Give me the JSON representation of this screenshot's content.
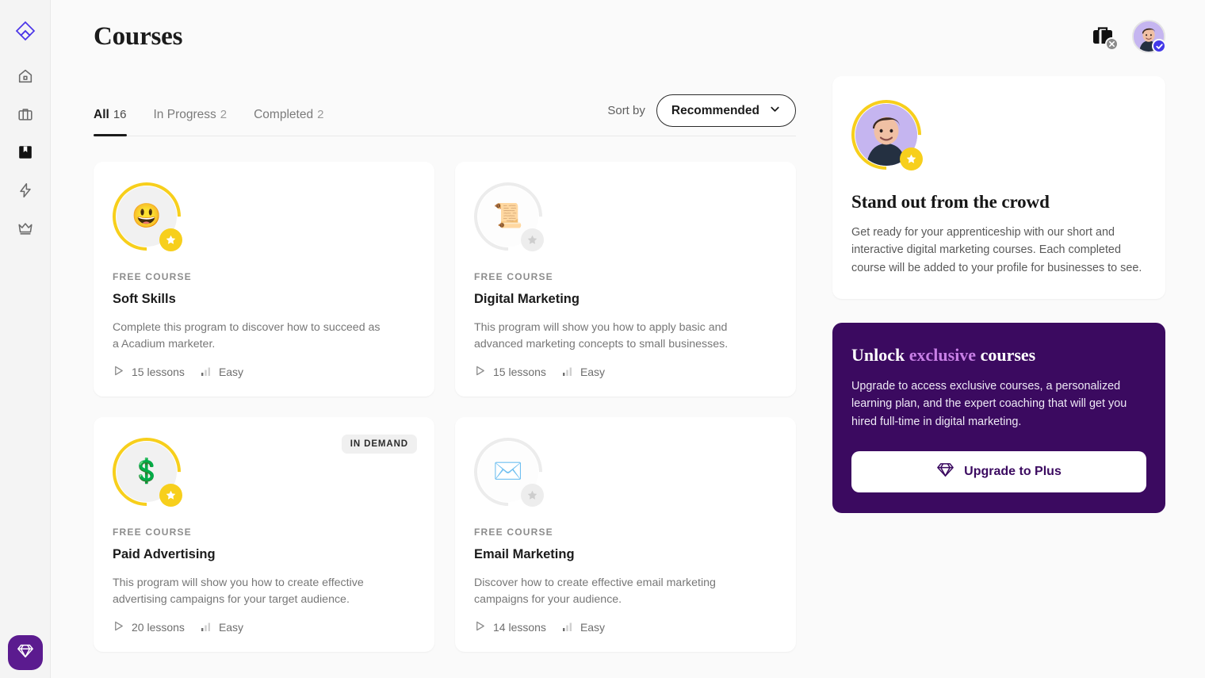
{
  "sidebar": {
    "logo_icon": "acadium-logo-icon",
    "items": [
      {
        "icon": "home-icon",
        "name": "home"
      },
      {
        "icon": "briefcase-icon",
        "name": "jobs"
      },
      {
        "icon": "book-icon",
        "name": "courses",
        "active": true
      },
      {
        "icon": "lightning-icon",
        "name": "activity"
      },
      {
        "icon": "crown-icon",
        "name": "premium"
      }
    ],
    "fab": {
      "icon": "diamond-icon",
      "name": "upgrade-fab"
    }
  },
  "header": {
    "title": "Courses",
    "bag_icon": "briefcase-icon",
    "bag_badge_icon": "close-x-icon",
    "avatar_icon": "user-avatar",
    "verified_icon": "check-badge-icon"
  },
  "tabs": [
    {
      "label": "All",
      "count": "16",
      "active": true
    },
    {
      "label": "In Progress",
      "count": "2",
      "active": false
    },
    {
      "label": "Completed",
      "count": "2",
      "active": false
    }
  ],
  "sort": {
    "label": "Sort by",
    "value": "Recommended",
    "chevron_icon": "chevron-down-icon"
  },
  "courses": [
    {
      "emoji": "😃",
      "emoji_name": "smiley-face-icon",
      "state": "earned",
      "eyebrow": "FREE COURSE",
      "title": "Soft Skills",
      "description": "Complete this program to discover how to succeed as a Acadium marketer.",
      "lessons": "15 lessons",
      "difficulty": "Easy",
      "badge": ""
    },
    {
      "emoji": "📜",
      "emoji_name": "scroll-icon",
      "state": "locked",
      "eyebrow": "FREE COURSE",
      "title": "Digital Marketing",
      "description": "This program will show you how to apply basic and advanced marketing concepts to small businesses.",
      "lessons": "15 lessons",
      "difficulty": "Easy",
      "badge": ""
    },
    {
      "emoji": "💲",
      "emoji_name": "dollar-coin-icon",
      "state": "earned",
      "eyebrow": "FREE COURSE",
      "title": "Paid Advertising",
      "description": "This program will show you how to create effective advertising campaigns for your target audience.",
      "lessons": "20 lessons",
      "difficulty": "Easy",
      "badge": "IN DEMAND"
    },
    {
      "emoji": "✉️",
      "emoji_name": "envelope-icon",
      "state": "locked",
      "eyebrow": "FREE COURSE",
      "title": "Email Marketing",
      "description": "Discover how to create effective email marketing campaigns for your audience.",
      "lessons": "14 lessons",
      "difficulty": "Easy",
      "badge": ""
    }
  ],
  "promo_profile": {
    "heading": "Stand out from the crowd",
    "body": "Get ready for your apprenticeship with our short and interactive digital marketing courses. Each  completed course will be added to your profile for businesses to see.",
    "avatar_icon": "user-avatar",
    "star_icon": "star-badge-icon"
  },
  "promo_plus": {
    "heading_pre": "Unlock ",
    "heading_accent": "exclusive",
    "heading_post": " courses",
    "body": "Upgrade to access exclusive courses, a personalized learning plan, and the expert coaching that will get you hired full-time in digital marketing.",
    "button_label": "Upgrade to Plus",
    "button_icon": "diamond-icon"
  },
  "colors": {
    "accent_purple": "#5b1b8f",
    "promo_bg": "#3b0a60",
    "accent_orchid": "#c87fe6",
    "ring_yellow": "#f7cf1c",
    "page_bg": "#fafafa"
  },
  "icons": {
    "play": "play-icon",
    "bars": "difficulty-bars-icon"
  }
}
